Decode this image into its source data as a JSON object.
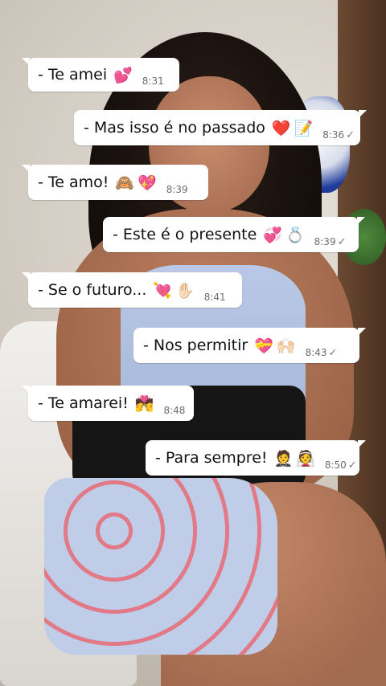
{
  "messages": [
    {
      "text": "- Te amei",
      "emoji": "💕",
      "time": "8:31",
      "direction": "in",
      "ticks": ""
    },
    {
      "text": "- Mas isso é no passado",
      "emoji": "❤️📝",
      "time": "8:36",
      "direction": "out",
      "ticks": "✓"
    },
    {
      "text": "-  Te amo!",
      "emoji": "🙈💖",
      "time": "8:39",
      "direction": "in",
      "ticks": ""
    },
    {
      "text": "- Este é o presente",
      "emoji": "💞💍",
      "time": "8:39",
      "direction": "out",
      "ticks": "✓"
    },
    {
      "text": "- Se o futuro...",
      "emoji": "💘✋🏻",
      "time": "8:41",
      "direction": "in",
      "ticks": ""
    },
    {
      "text": "-  Nos permitir",
      "emoji": "💝🙌🏻",
      "time": "8:43",
      "direction": "out",
      "ticks": "✓"
    },
    {
      "text": "- Te amarei!",
      "emoji": "💏",
      "time": "8:48",
      "direction": "in",
      "ticks": ""
    },
    {
      "text": "- Para sempre!",
      "emoji": "🤵👰",
      "time": "8:50",
      "direction": "out",
      "ticks": "✓"
    }
  ],
  "colors": {
    "bubble": "#ffffff",
    "text": "#111111",
    "time": "#6d6d6d"
  }
}
